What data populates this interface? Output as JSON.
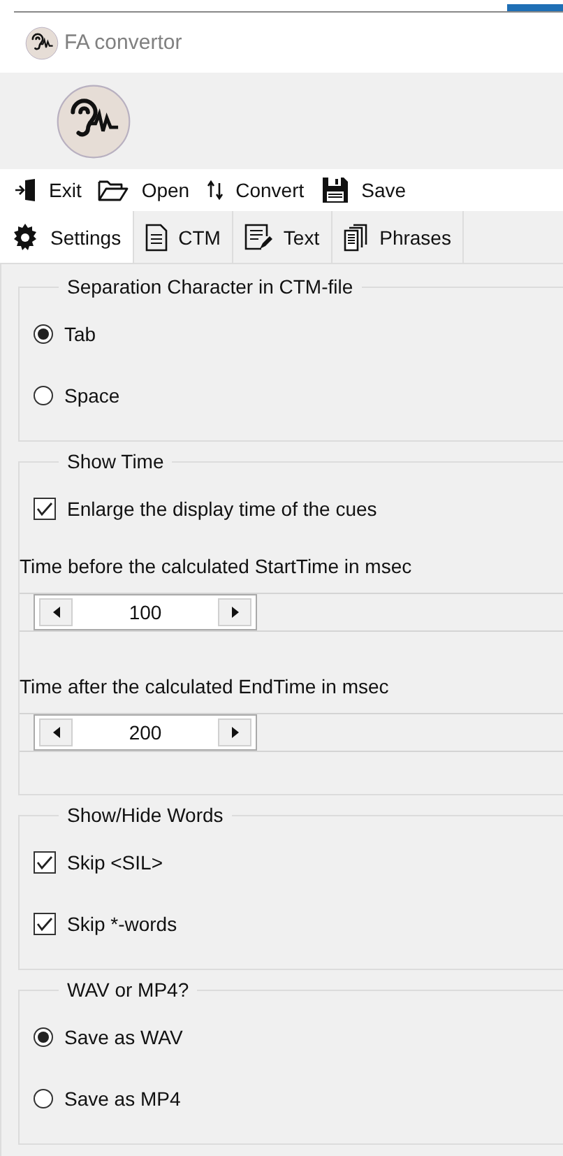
{
  "window": {
    "title": "FA convertor"
  },
  "toolbar": [
    {
      "label": "Exit"
    },
    {
      "label": "Open"
    },
    {
      "label": "Convert"
    },
    {
      "label": "Save"
    }
  ],
  "tabs": [
    {
      "label": "Settings",
      "selected": true
    },
    {
      "label": "CTM",
      "selected": false
    },
    {
      "label": "Text",
      "selected": false
    },
    {
      "label": "Phrases",
      "selected": false
    }
  ],
  "groups": [
    {
      "title": "Separation Character in CTM-file",
      "items": [
        {
          "kind": "radio",
          "label": "Tab",
          "selected": true
        },
        {
          "kind": "radio",
          "label": "Space",
          "selected": false
        }
      ]
    },
    {
      "title": "Show Time",
      "items": [
        {
          "kind": "checkbox",
          "label": "Enlarge the display time of the cues",
          "checked": true
        },
        {
          "kind": "label",
          "text": "Time before the calculated StartTime in msec"
        },
        {
          "kind": "spinner",
          "value": "100"
        },
        {
          "kind": "label",
          "text": "Time after the calculated EndTime in msec"
        },
        {
          "kind": "spinner",
          "value": "200"
        }
      ]
    },
    {
      "title": "Show/Hide Words",
      "items": [
        {
          "kind": "checkbox",
          "label": "Skip <SIL>",
          "checked": true
        },
        {
          "kind": "checkbox",
          "label": "Skip *-words",
          "checked": true
        }
      ]
    },
    {
      "title": "WAV or MP4?",
      "items": [
        {
          "kind": "radio",
          "label": "Save as WAV",
          "selected": true
        },
        {
          "kind": "radio",
          "label": "Save as MP4",
          "selected": false
        }
      ]
    }
  ]
}
